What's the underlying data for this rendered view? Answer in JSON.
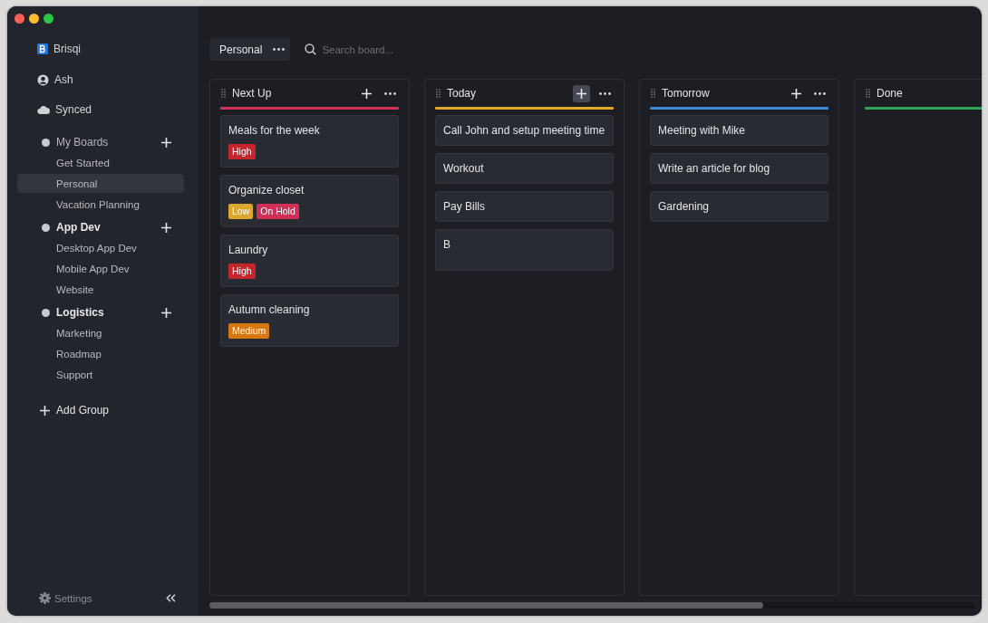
{
  "app": {
    "name": "Brisqi"
  },
  "sidebar": {
    "user": "Ash",
    "sync_status": "Synced",
    "groups": [
      {
        "name": "My Boards",
        "boards": [
          {
            "name": "Get Started",
            "selected": false
          },
          {
            "name": "Personal",
            "selected": true
          },
          {
            "name": "Vacation Planning",
            "selected": false
          }
        ]
      },
      {
        "name": "App Dev",
        "boards": [
          {
            "name": "Desktop App Dev",
            "selected": false
          },
          {
            "name": "Mobile App Dev",
            "selected": false
          },
          {
            "name": "Website",
            "selected": false
          }
        ]
      },
      {
        "name": "Logistics",
        "boards": [
          {
            "name": "Marketing",
            "selected": false
          },
          {
            "name": "Roadmap",
            "selected": false
          },
          {
            "name": "Support",
            "selected": false
          }
        ]
      }
    ],
    "add_group": "Add Group",
    "settings": "Settings"
  },
  "toolbar": {
    "board_tab": "Personal",
    "search": {
      "placeholder": "Search board..."
    }
  },
  "columns": [
    {
      "title": "Next Up",
      "color": "#d2335a",
      "add_hovered": false,
      "cards": [
        {
          "kind": "task",
          "title": "Meals for the week",
          "tags": [
            {
              "label": "High",
              "color": "#c4262c"
            }
          ]
        },
        {
          "kind": "task",
          "title": "Organize closet",
          "tags": [
            {
              "label": "Low",
              "color": "#dca72d"
            },
            {
              "label": "On Hold",
              "color": "#d02f58"
            }
          ]
        },
        {
          "kind": "task",
          "title": "Laundry",
          "tags": [
            {
              "label": "High",
              "color": "#c4262c"
            }
          ]
        },
        {
          "kind": "task",
          "title": "Autumn cleaning",
          "tags": [
            {
              "label": "Medium",
              "color": "#d7770f"
            }
          ]
        }
      ]
    },
    {
      "title": "Today",
      "color": "#e0a92c",
      "add_hovered": true,
      "cards": [
        {
          "kind": "task",
          "title": "Call John and setup meeting time"
        },
        {
          "kind": "task",
          "title": "Workout"
        },
        {
          "kind": "task",
          "title": "Pay Bills"
        },
        {
          "kind": "editor",
          "value": "B"
        }
      ]
    },
    {
      "title": "Tomorrow",
      "color": "#3b8ad6",
      "add_hovered": false,
      "cards": [
        {
          "kind": "task",
          "title": "Meeting with Mike"
        },
        {
          "kind": "task",
          "title": "Write an article for blog"
        },
        {
          "kind": "task",
          "title": "Gardening"
        }
      ]
    },
    {
      "title": "Done",
      "color": "#2fa35a"
    }
  ]
}
